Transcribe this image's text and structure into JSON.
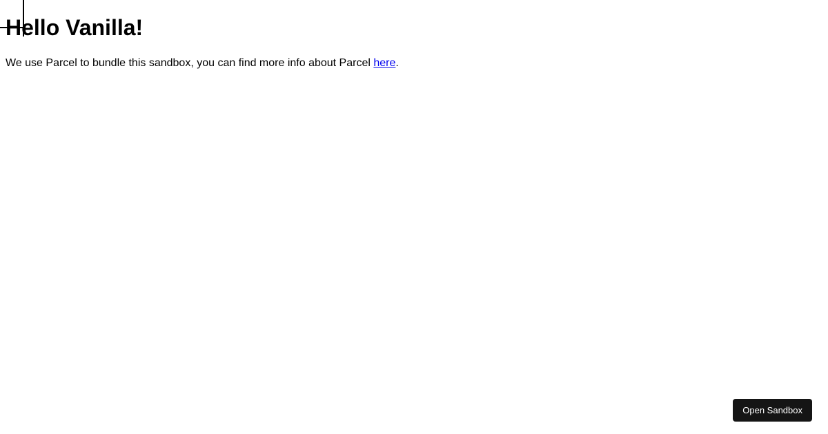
{
  "heading": "Hello Vanilla!",
  "paragraph": {
    "text_before_link": "We use Parcel to bundle this sandbox, you can find more info about Parcel ",
    "link_text": "here",
    "text_after_link": "."
  },
  "button": {
    "open_sandbox_label": "Open Sandbox"
  }
}
